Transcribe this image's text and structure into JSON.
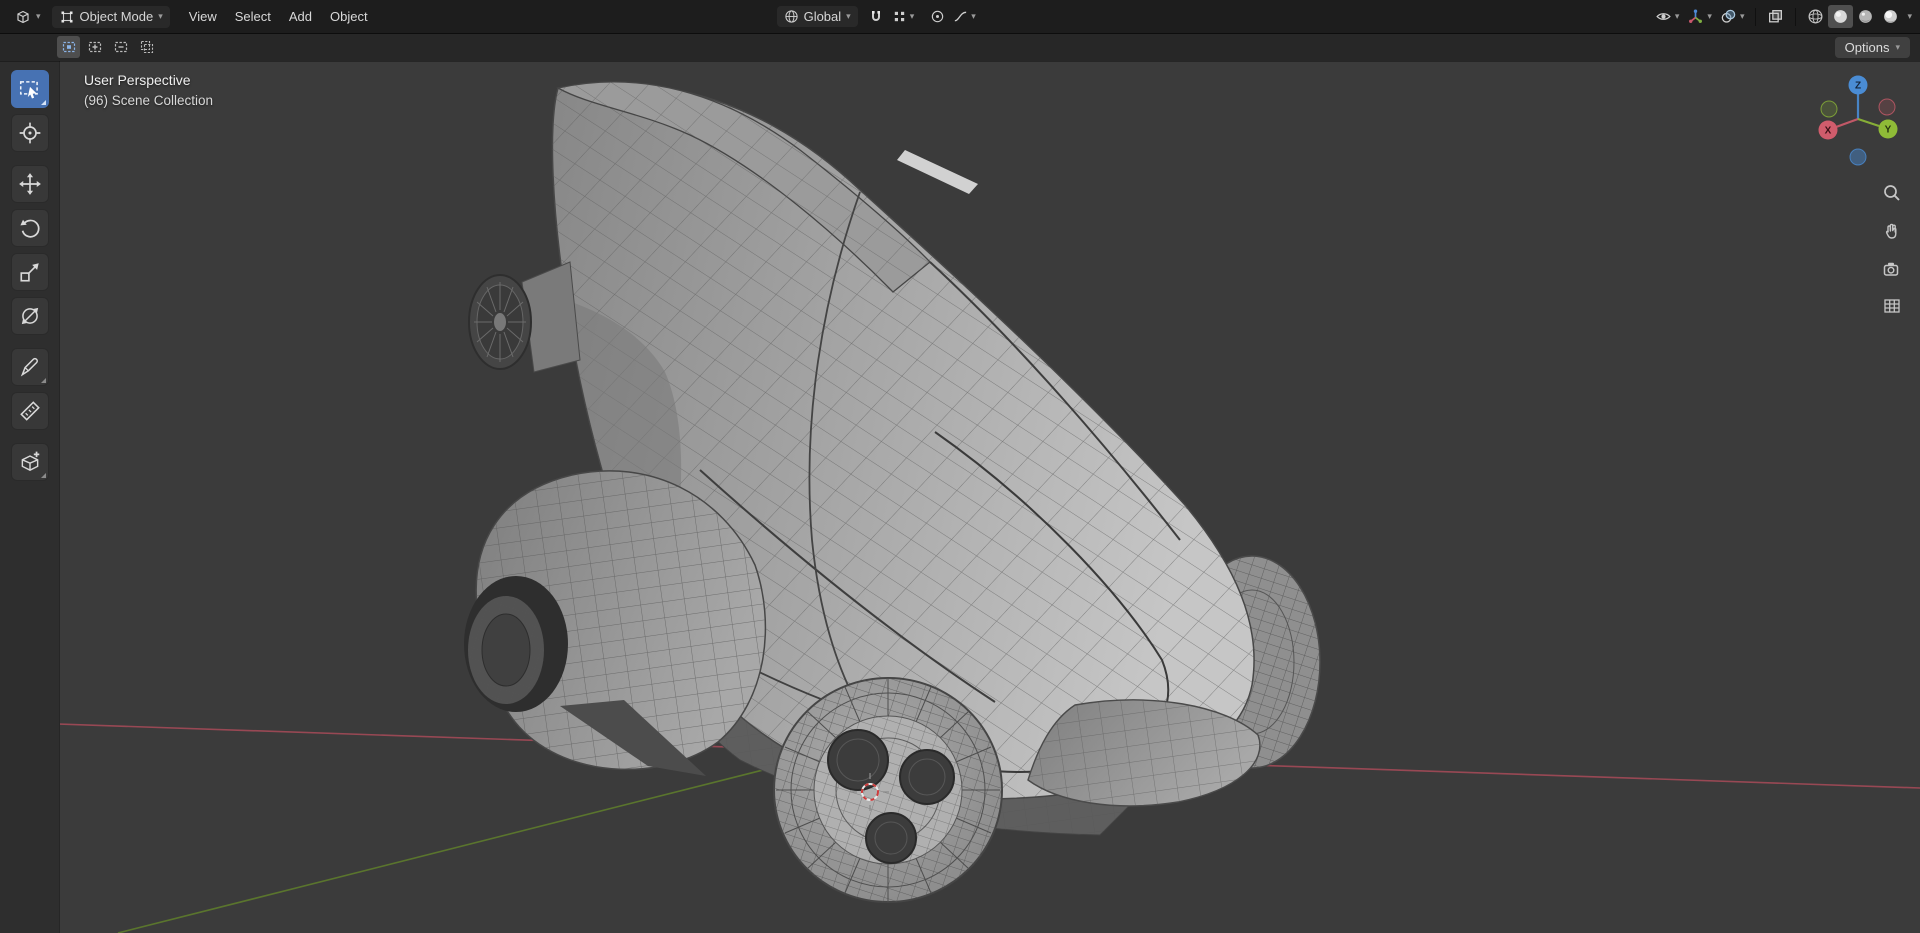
{
  "header": {
    "mode_label": "Object Mode",
    "menus": [
      {
        "label": "View"
      },
      {
        "label": "Select"
      },
      {
        "label": "Add"
      },
      {
        "label": "Object"
      }
    ],
    "orientation_label": "Global",
    "shading_modes": [
      "wireframe",
      "solid",
      "material",
      "rendered"
    ],
    "active_shading": "solid"
  },
  "tool_settings": {
    "options_label": "Options",
    "select_modes": [
      "set",
      "extend",
      "subtract",
      "intersect"
    ],
    "active_select_mode": "set"
  },
  "toolbar": {
    "tools": [
      {
        "name": "select-box",
        "active": true
      },
      {
        "name": "cursor",
        "active": false
      },
      {
        "name": "move",
        "active": false
      },
      {
        "name": "rotate",
        "active": false
      },
      {
        "name": "scale",
        "active": false
      },
      {
        "name": "transform",
        "active": false
      },
      {
        "name": "annotate",
        "active": false
      },
      {
        "name": "measure",
        "active": false
      },
      {
        "name": "add-cube",
        "active": false
      }
    ]
  },
  "viewport": {
    "perspective_label": "User Perspective",
    "collection_label": "(96) Scene Collection",
    "axes": {
      "x": "X",
      "y": "Y",
      "z": "Z"
    }
  },
  "icons": {
    "chevron_down": "▾",
    "chevron_left": "‹"
  },
  "colors": {
    "accent": "#4772b3",
    "header_bg": "#1d1d1d",
    "viewport_bg": "#3b3b3b",
    "axis_x": "#d05c6c",
    "axis_y": "#8fbb37",
    "axis_z": "#4a8cd4"
  }
}
